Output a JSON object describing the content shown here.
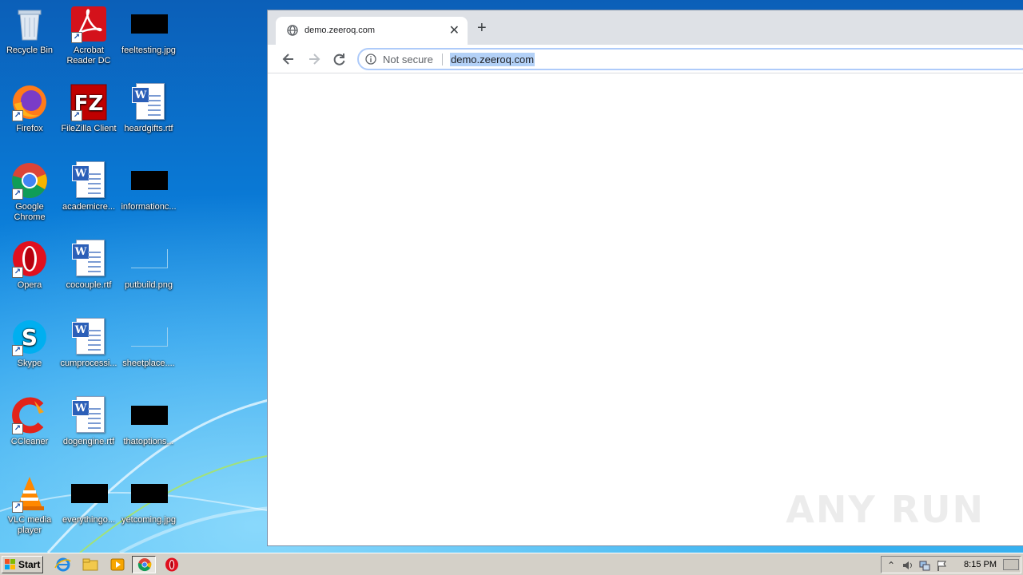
{
  "desktop": {
    "icons": [
      {
        "label": "Recycle Bin",
        "icon": "recycle-bin-icon"
      },
      {
        "label": "Acrobat Reader DC",
        "icon": "acrobat-icon"
      },
      {
        "label": "feeltesting.jpg",
        "icon": "image-file-icon"
      },
      {
        "label": "Firefox",
        "icon": "firefox-icon"
      },
      {
        "label": "FileZilla Client",
        "icon": "filezilla-icon"
      },
      {
        "label": "heardgifts.rtf",
        "icon": "word-doc-icon"
      },
      {
        "label": "Google Chrome",
        "icon": "chrome-icon"
      },
      {
        "label": "academicre...",
        "icon": "word-doc-icon"
      },
      {
        "label": "informationc...",
        "icon": "image-file-icon"
      },
      {
        "label": "Opera",
        "icon": "opera-icon"
      },
      {
        "label": "cocouple.rtf",
        "icon": "word-doc-icon"
      },
      {
        "label": "putbuild.png",
        "icon": "image-file-icon"
      },
      {
        "label": "Skype",
        "icon": "skype-icon"
      },
      {
        "label": "cumprocessi...",
        "icon": "word-doc-icon"
      },
      {
        "label": "sheetplace....",
        "icon": "image-file-icon"
      },
      {
        "label": "CCleaner",
        "icon": "ccleaner-icon"
      },
      {
        "label": "dogengine.rtf",
        "icon": "word-doc-icon"
      },
      {
        "label": "thatoptions...",
        "icon": "image-file-icon"
      },
      {
        "label": "VLC media player",
        "icon": "vlc-icon"
      },
      {
        "label": "everythingo...",
        "icon": "image-file-icon"
      },
      {
        "label": "yetcoming.jpg",
        "icon": "image-file-icon"
      }
    ]
  },
  "browser": {
    "tab_title": "demo.zeeroq.com",
    "security_label": "Not secure",
    "url": "demo.zeeroq.com",
    "watermark": "ANY RUN"
  },
  "taskbar": {
    "start_label": "Start",
    "clock": "8:15 PM"
  },
  "colors": {
    "chrome_tabstrip": "#dee1e6",
    "url_highlight": "#b3d1f7",
    "taskbar": "#d4d0c8"
  }
}
